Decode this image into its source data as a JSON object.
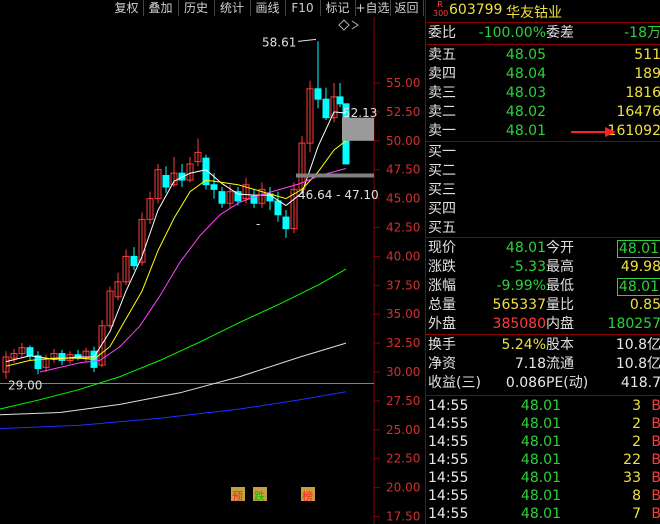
{
  "toolbar": {
    "items": [
      "复权",
      "叠加",
      "历史",
      "统计",
      "画线",
      "F10",
      "标记",
      "+自选",
      "返回"
    ]
  },
  "header": {
    "badge_top": "R",
    "badge_bottom": "300",
    "code": "603799",
    "name": "华友钴业"
  },
  "order_book": {
    "weibi_label": "委比",
    "weibi_value": "-100.00%",
    "weicha_label": "委差",
    "weicha_value": "-18万",
    "asks": [
      {
        "label": "卖五",
        "price": "48.05",
        "volume": "511"
      },
      {
        "label": "卖四",
        "price": "48.04",
        "volume": "189"
      },
      {
        "label": "卖三",
        "price": "48.03",
        "volume": "1816"
      },
      {
        "label": "卖二",
        "price": "48.02",
        "volume": "16476"
      },
      {
        "label": "卖一",
        "price": "48.01",
        "volume": "161092"
      }
    ],
    "bids": [
      {
        "label": "买一"
      },
      {
        "label": "买二"
      },
      {
        "label": "买三"
      },
      {
        "label": "买四"
      },
      {
        "label": "买五"
      }
    ]
  },
  "quote": {
    "xianjia_label": "现价",
    "xianjia": "48.01",
    "jinkai_label": "今开",
    "jinkai": "48.01",
    "zhangdie_label": "涨跌",
    "zhangdie": "-5.33",
    "zuigao_label": "最高",
    "zuigao": "49.98",
    "zhangfu_label": "涨幅",
    "zhangfu": "-9.99%",
    "zuidi_label": "最低",
    "zuidi": "48.01",
    "zongliang_label": "总量",
    "zongliang": "565337",
    "liangbi_label": "量比",
    "liangbi": "0.85",
    "waipan_label": "外盘",
    "waipan": "385080",
    "neipan_label": "内盘",
    "neipan": "180257",
    "huanshou_label": "换手",
    "huanshou": "5.24%",
    "guben_label": "股本",
    "guben": "10.8亿",
    "jingzi_label": "净资",
    "jingzi": "7.18",
    "liutong_label": "流通",
    "liutong": "10.8亿",
    "shouyi_label": "收益(三)",
    "shouyi": "0.086",
    "pe_label": "PE(动)",
    "pe": "418.7"
  },
  "ticks": [
    {
      "time": "14:55",
      "price": "48.01",
      "volume": "3",
      "side": "B"
    },
    {
      "time": "14:55",
      "price": "48.01",
      "volume": "2",
      "side": "B"
    },
    {
      "time": "14:55",
      "price": "48.01",
      "volume": "2",
      "side": "B"
    },
    {
      "time": "14:55",
      "price": "48.01",
      "volume": "22",
      "side": "B"
    },
    {
      "time": "14:55",
      "price": "48.01",
      "volume": "33",
      "side": "B"
    },
    {
      "time": "14:55",
      "price": "48.01",
      "volume": "8",
      "side": "B"
    },
    {
      "time": "14:55",
      "price": "48.01",
      "volume": "7",
      "side": "B"
    }
  ],
  "chart_data": {
    "type": "candlestick",
    "y_ticks": [
      "55.00",
      "52.50",
      "50.00",
      "47.50",
      "45.00",
      "42.50",
      "40.00",
      "37.50",
      "35.00",
      "32.50",
      "30.00",
      "27.50",
      "25.00",
      "22.50",
      "20.00",
      "17.50"
    ],
    "ylim": [
      16.5,
      58.9
    ],
    "annotations": {
      "high_label": "58.61",
      "right_label": "52.13",
      "range_label": "46.64 - 47.10",
      "low_label": "29.00"
    },
    "markers": [
      "预",
      "跌",
      "榜"
    ],
    "colors": {
      "up": "#ff3c3c",
      "down": "#00ffff",
      "ma5": "#ffffff",
      "ma10": "#ffff00",
      "ma20": "#ff40ff",
      "ma60": "#00ff00",
      "ma120": "#e0e0e0",
      "ma250": "#2030ff"
    }
  }
}
